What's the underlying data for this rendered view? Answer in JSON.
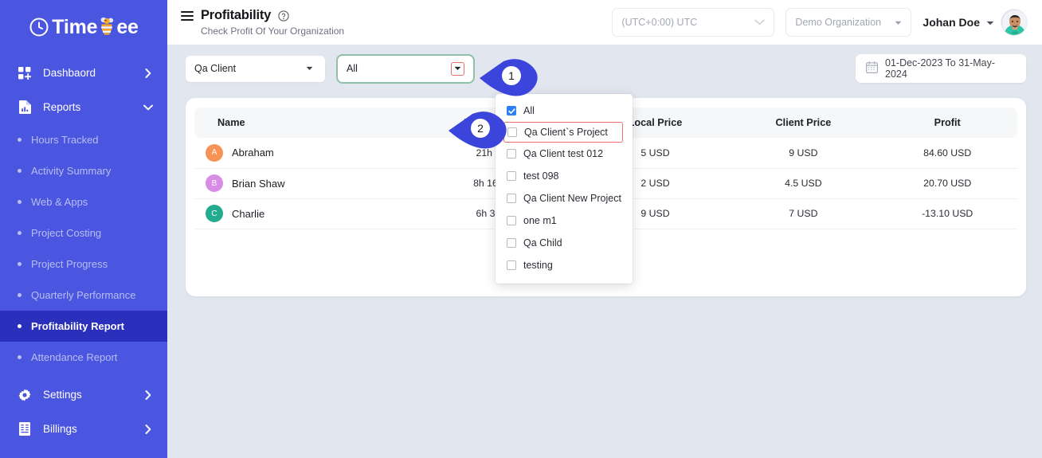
{
  "brand": {
    "name_part1": "Time",
    "name_part2": "ee",
    "sidebar_color": "#4a55e0",
    "active_color": "#2a30bb"
  },
  "sidebar": {
    "items": [
      {
        "label": "Dashbaord",
        "icon": "grid-plus-icon",
        "chevron": "chevron-right-icon",
        "type": "parent"
      },
      {
        "label": "Reports",
        "icon": "report-chart-icon",
        "chevron": "chevron-down-icon",
        "type": "parent"
      }
    ],
    "reports_subitems": [
      {
        "label": "Hours Tracked",
        "active": false
      },
      {
        "label": "Activity Summary",
        "active": false
      },
      {
        "label": "Web & Apps",
        "active": false
      },
      {
        "label": "Project Costing",
        "active": false
      },
      {
        "label": "Project Progress",
        "active": false
      },
      {
        "label": "Quarterly Performance",
        "active": false
      },
      {
        "label": "Profitability Report",
        "active": true
      },
      {
        "label": "Attendance Report",
        "active": false
      }
    ],
    "bottom_items": [
      {
        "label": "Settings",
        "icon": "gear-icon",
        "chevron": "chevron-right-icon"
      },
      {
        "label": "Billings",
        "icon": "invoice-icon",
        "chevron": "chevron-right-icon"
      }
    ]
  },
  "topbar": {
    "menu_icon": "hamburger-icon",
    "title": "Profitability",
    "help_icon": "help-circle-icon",
    "subtitle": "Check Profit Of Your Organization",
    "timezone": "(UTC+0:00) UTC",
    "organization": "Demo Organization",
    "user_name": "Johan Doe"
  },
  "filters": {
    "client_select": "Qa Client",
    "project_select": "All",
    "date_range": "01-Dec-2023 To 31-May-2024",
    "calendar_icon": "calendar-icon",
    "focus_border_color": "#8ec1a5",
    "highlight_border_color": "#ef6d6d"
  },
  "dropdown": {
    "options": [
      {
        "label": "All",
        "checked": true,
        "highlighted": false
      },
      {
        "label": "Qa Client`s Project",
        "checked": false,
        "highlighted": true
      },
      {
        "label": "Qa Client test 012",
        "checked": false,
        "highlighted": false
      },
      {
        "label": "test 098",
        "checked": false,
        "highlighted": false
      },
      {
        "label": "Qa Client New Project",
        "checked": false,
        "highlighted": false
      },
      {
        "label": "one m1",
        "checked": false,
        "highlighted": false
      },
      {
        "label": "Qa Child",
        "checked": false,
        "highlighted": false
      },
      {
        "label": "testing",
        "checked": false,
        "highlighted": false
      }
    ]
  },
  "table": {
    "columns": [
      "Name",
      "Worked Hours",
      "Local Price",
      "Client Price",
      "Profit"
    ],
    "rows": [
      {
        "initial": "A",
        "avatar_color": "#f79256",
        "name": "Abraham",
        "worked_hours": "21h 9m 2s",
        "local_price": "5 USD",
        "client_price": "9 USD",
        "profit": "84.60 USD"
      },
      {
        "initial": "B",
        "avatar_color": "#d98ce6",
        "name": "Brian Shaw",
        "worked_hours": "8h 16m 48s",
        "local_price": "2 USD",
        "client_price": "4.5 USD",
        "profit": "20.70 USD"
      },
      {
        "initial": "C",
        "avatar_color": "#22ab8e",
        "name": "Charlie",
        "worked_hours": "6h 33m 0s",
        "local_price": "9 USD",
        "client_price": "7 USD",
        "profit": "-13.10 USD"
      }
    ]
  },
  "annotations": [
    {
      "number": "1",
      "color": "#3b45dc"
    },
    {
      "number": "2",
      "color": "#3b45dc"
    }
  ]
}
